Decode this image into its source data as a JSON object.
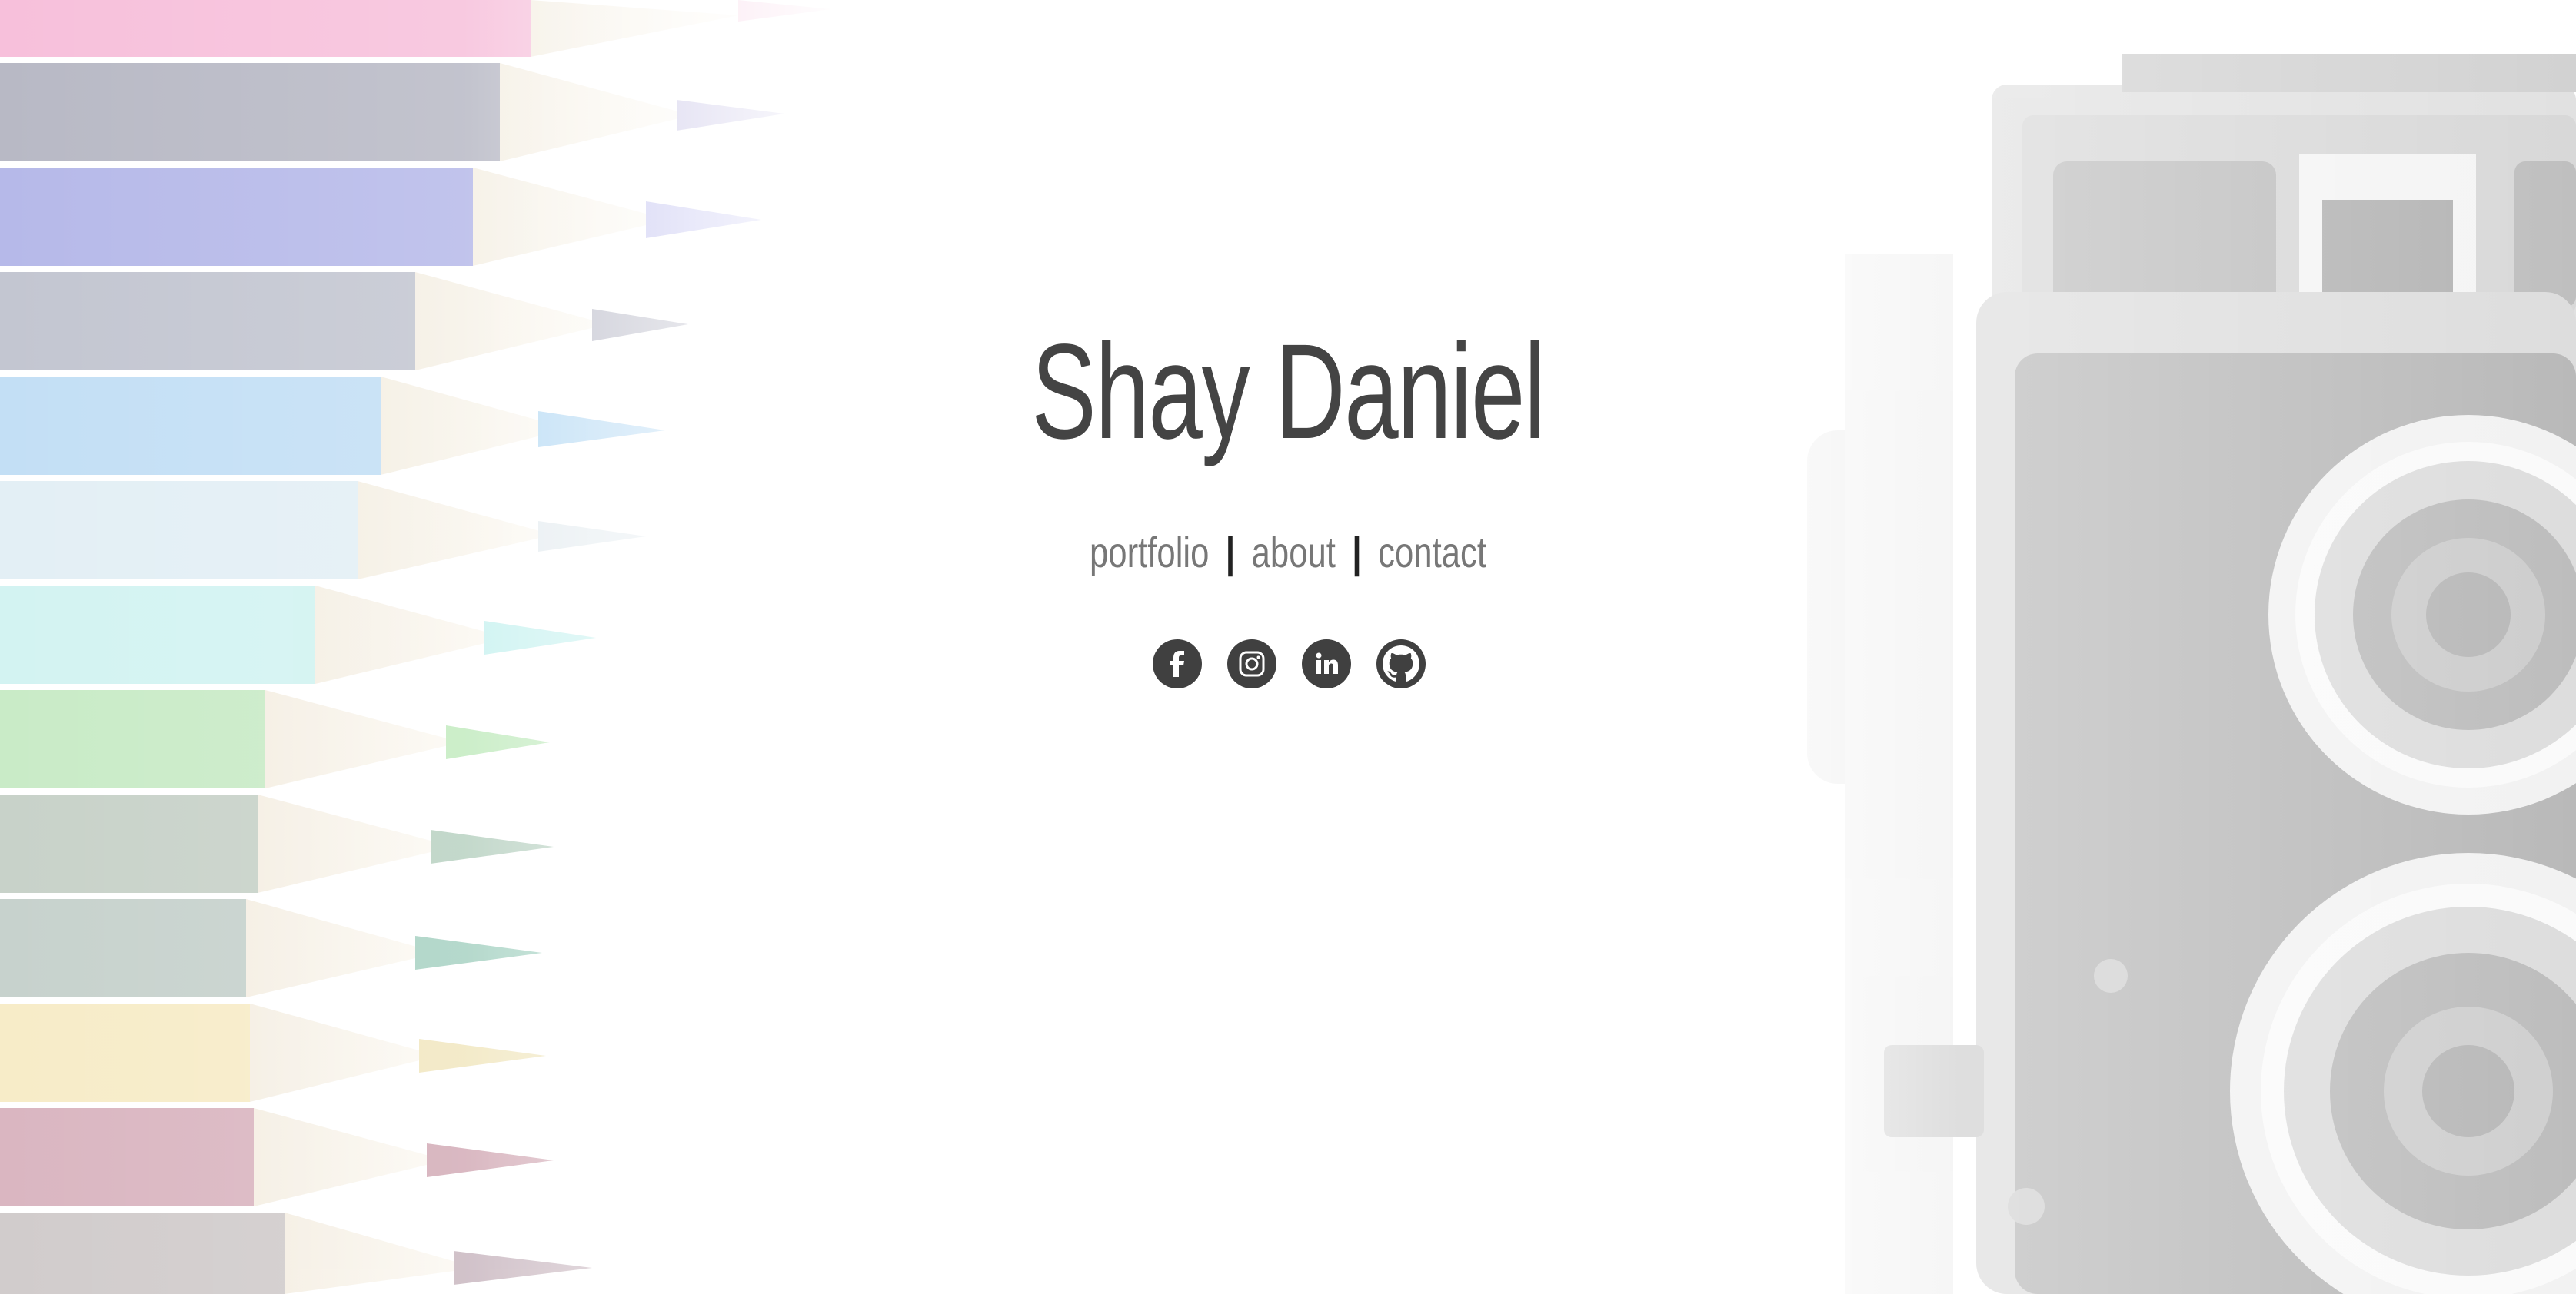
{
  "header": {
    "title": "Shay Daniel"
  },
  "nav": {
    "items": [
      {
        "label": "portfolio"
      },
      {
        "label": "about"
      },
      {
        "label": "contact"
      }
    ],
    "separator": "|"
  },
  "socials": [
    {
      "icon": "facebook-icon"
    },
    {
      "icon": "instagram-icon"
    },
    {
      "icon": "linkedin-icon"
    },
    {
      "icon": "github-icon"
    }
  ],
  "colors": {
    "title": "#444444",
    "nav_link": "#777777",
    "separator": "#222222",
    "social_bg": "#404040",
    "background": "#ffffff"
  }
}
